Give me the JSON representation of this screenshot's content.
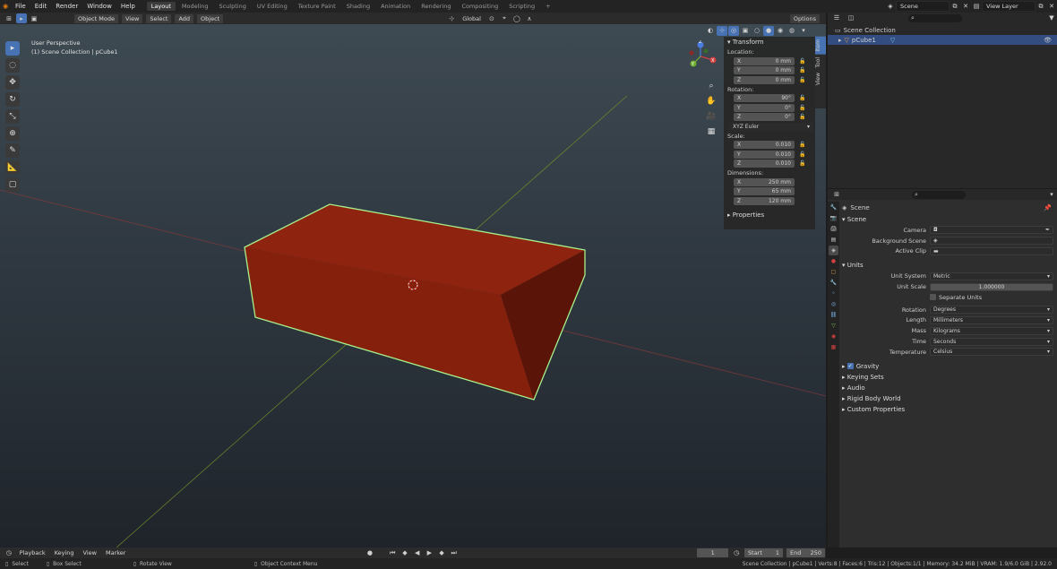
{
  "topbar": {
    "menus": [
      "File",
      "Edit",
      "Render",
      "Window",
      "Help"
    ],
    "workspaces": [
      "Layout",
      "Modeling",
      "Sculpting",
      "UV Editing",
      "Texture Paint",
      "Shading",
      "Animation",
      "Rendering",
      "Compositing",
      "Scripting"
    ],
    "add_tab": "+",
    "scene_label": "Scene",
    "view_layer_label": "View Layer"
  },
  "vheader": {
    "mode": "Object Mode",
    "menus": [
      "View",
      "Select",
      "Add",
      "Object"
    ],
    "orientation": "Global",
    "options": "Options"
  },
  "viewport": {
    "perspective": "User Perspective",
    "collection": "(1) Scene Collection | pCube1",
    "gizmo": {
      "x": "X",
      "y": "Y",
      "z": "Z"
    }
  },
  "npanel": {
    "transform_header": "Transform",
    "location_label": "Location:",
    "location": [
      {
        "axis": "X",
        "value": "0 mm"
      },
      {
        "axis": "Y",
        "value": "0 mm"
      },
      {
        "axis": "Z",
        "value": "0 mm"
      }
    ],
    "rotation_label": "Rotation:",
    "rotation": [
      {
        "axis": "X",
        "value": "90°"
      },
      {
        "axis": "Y",
        "value": "0°"
      },
      {
        "axis": "Z",
        "value": "0°"
      }
    ],
    "rotation_mode": "XYZ Euler",
    "scale_label": "Scale:",
    "scale": [
      {
        "axis": "X",
        "value": "0.010"
      },
      {
        "axis": "Y",
        "value": "0.010"
      },
      {
        "axis": "Z",
        "value": "0.010"
      }
    ],
    "dimensions_label": "Dimensions:",
    "dimensions": [
      {
        "axis": "X",
        "value": "250 mm"
      },
      {
        "axis": "Y",
        "value": "65 mm"
      },
      {
        "axis": "Z",
        "value": "120 mm"
      }
    ],
    "properties_header": "Properties",
    "tabs": [
      "Item",
      "Tool",
      "View"
    ]
  },
  "outliner": {
    "root": "Scene Collection",
    "items": [
      {
        "label": "pCube1"
      }
    ]
  },
  "props": {
    "scene_title": "Scene",
    "scene_section": "Scene",
    "camera_label": "Camera",
    "bg_scene_label": "Background Scene",
    "active_clip_label": "Active Clip",
    "units_section": "Units",
    "unit_system_label": "Unit System",
    "unit_system": "Metric",
    "unit_scale_label": "Unit Scale",
    "unit_scale": "1.000000",
    "separate_units": "Separate Units",
    "rotation_label": "Rotation",
    "rotation": "Degrees",
    "length_label": "Length",
    "length": "Millimeters",
    "mass_label": "Mass",
    "mass": "Kilograms",
    "time_label": "Time",
    "time": "Seconds",
    "temperature_label": "Temperature",
    "temperature": "Celsius",
    "gravity": "Gravity",
    "collapsed": [
      "Keying Sets",
      "Audio",
      "Rigid Body World",
      "Custom Properties"
    ]
  },
  "timeline": {
    "menus": [
      "Playback",
      "Keying",
      "View",
      "Marker"
    ],
    "current_frame": "1",
    "start_label": "Start",
    "start": "1",
    "end_label": "End",
    "end": "250"
  },
  "status": {
    "select": "Select",
    "box_select": "Box Select",
    "rotate_view": "Rotate View",
    "context_menu": "Object Context Menu",
    "stats": "Scene Collection | pCube1 | Verts:8 | Faces:6 | Tris:12 | Objects:1/1 | Memory: 34.2 MiB | VRAM: 1.9/6.0 GiB | 2.92.0"
  },
  "colors": {
    "accent": "#4772b3",
    "cube": "#8a2010",
    "select_outline": "#a8f08a"
  }
}
